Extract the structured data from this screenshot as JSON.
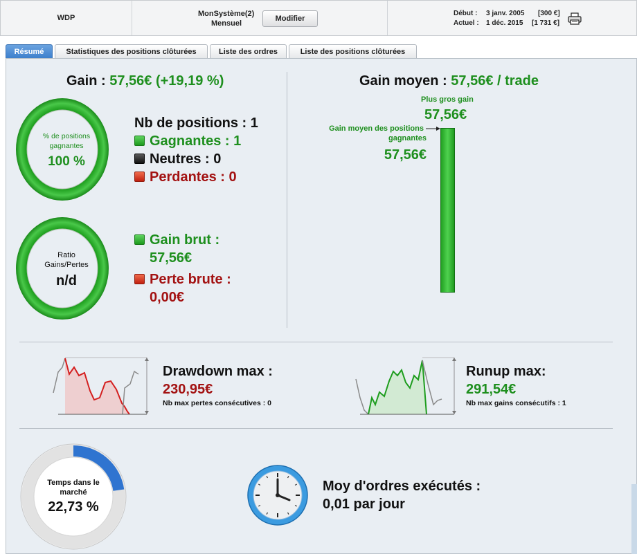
{
  "header": {
    "symbol": "WDP",
    "system_line1": "MonSystème(2)",
    "system_line2": "Mensuel",
    "modify_button": "Modifier",
    "start_label": "Début :",
    "start_date": "3 janv. 2005",
    "start_value": "[300 €]",
    "current_label": "Actuel :",
    "current_date": "1 déc. 2015",
    "current_value": "[1 731 €]"
  },
  "tabs": [
    {
      "label": "Résumé",
      "active": true
    },
    {
      "label": "Statistiques des positions clôturées",
      "active": false
    },
    {
      "label": "Liste des ordres",
      "active": false
    },
    {
      "label": "Liste des positions clôturées",
      "active": false
    }
  ],
  "gain": {
    "label": "Gain :",
    "value": "57,56€ (+19,19 %)"
  },
  "winning_ring": {
    "label_line1": "% de positions",
    "label_line2": "gagnantes",
    "value": "100 %",
    "fraction": 1.0
  },
  "positions": {
    "total_label": "Nb de positions : 1",
    "winners_label": "Gagnantes : 1",
    "neutral_label": "Neutres : 0",
    "losers_label": "Perdantes : 0"
  },
  "ratio_ring": {
    "label_line1": "Ratio",
    "label_line2": "Gains/Pertes",
    "value": "n/d"
  },
  "gross": {
    "gain_label": "Gain brut :",
    "gain_value": "57,56€",
    "loss_label": "Perte brute :",
    "loss_value": "0,00€"
  },
  "avg_gain": {
    "label": "Gain moyen :",
    "value": "57,56€ / trade",
    "max_gain_label": "Plus gros gain",
    "max_gain_value": "57,56€",
    "avg_win_label_line1": "Gain moyen des positions",
    "avg_win_label_line2": "gagnantes",
    "avg_win_value": "57,56€"
  },
  "drawdown": {
    "label": "Drawdown max :",
    "value": "230,95€",
    "sub_label": "Nb max pertes consécutives : 0"
  },
  "runup": {
    "label": "Runup max:",
    "value": "291,54€",
    "sub_label": "Nb max gains consécutifs : 1"
  },
  "market_time": {
    "label_line1": "Temps dans le",
    "label_line2": "marché",
    "value": "22,73 %",
    "fraction": 0.2273
  },
  "orders": {
    "label": "Moy d'ordres exécutés :",
    "value": "0,01 par jour"
  },
  "colors": {
    "green": "#1e8f1e",
    "red": "#a31212",
    "tab_active": "#3d7fcc",
    "panel": "#e9eef3"
  }
}
